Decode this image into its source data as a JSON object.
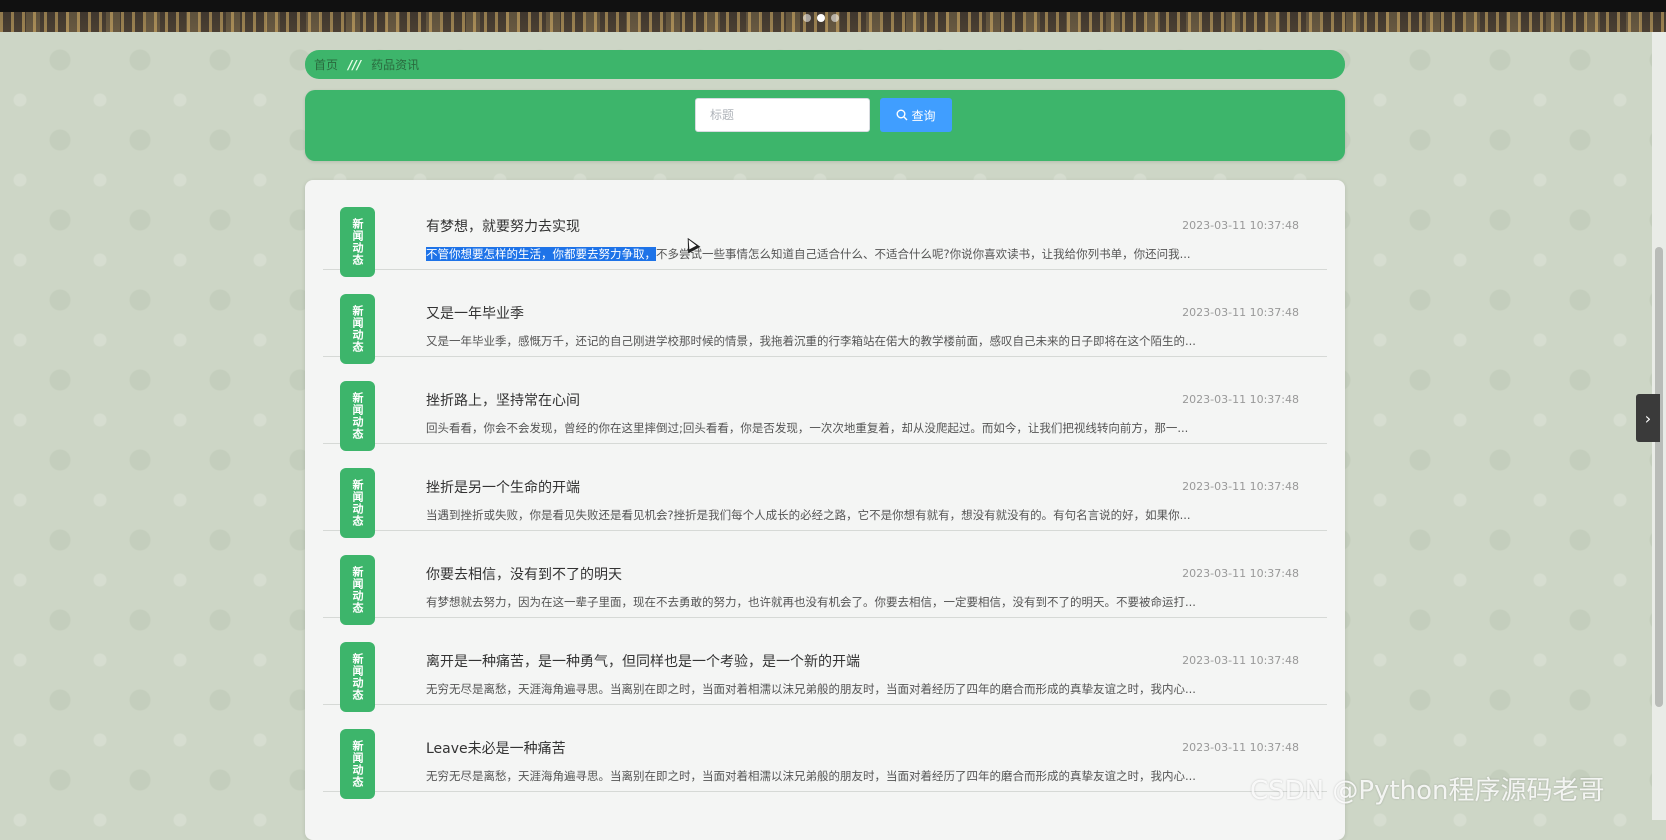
{
  "banner": {
    "slides": 3,
    "active_slide": 2
  },
  "breadcrumb": {
    "home": "首页",
    "separator": "///",
    "current": "药品资讯"
  },
  "search": {
    "placeholder": "标题",
    "value": "",
    "button_label": "查询",
    "button_icon": "search-icon"
  },
  "badge_text": "新闻动态",
  "news": [
    {
      "title": "有梦想，就要努力去实现",
      "time": "2023-03-11 10:37:48",
      "summary_selected": "不管你想要怎样的生活，你都要去努力争取，",
      "summary": "不多尝试一些事情怎么知道自己适合什么、不适合什么呢?你说你喜欢读书，让我给你列书单，你还问我..."
    },
    {
      "title": "又是一年毕业季",
      "time": "2023-03-11 10:37:48",
      "summary_selected": "",
      "summary": "又是一年毕业季，感慨万千，还记的自己刚进学校那时候的情景，我拖着沉重的行李箱站在偌大的教学楼前面，感叹自己未来的日子即将在这个陌生的..."
    },
    {
      "title": "挫折路上，坚持常在心间",
      "time": "2023-03-11 10:37:48",
      "summary_selected": "",
      "summary": "回头看看，你会不会发现，曾经的你在这里摔倒过;回头看看，你是否发现，一次次地重复着，却从没爬起过。而如今，让我们把视线转向前方，那一..."
    },
    {
      "title": "挫折是另一个生命的开端",
      "time": "2023-03-11 10:37:48",
      "summary_selected": "",
      "summary": "当遇到挫折或失败，你是看见失败还是看见机会?挫折是我们每个人成长的必经之路，它不是你想有就有，想没有就没有的。有句名言说的好，如果你..."
    },
    {
      "title": "你要去相信，没有到不了的明天",
      "time": "2023-03-11 10:37:48",
      "summary_selected": "",
      "summary": "有梦想就去努力，因为在这一辈子里面，现在不去勇敢的努力，也许就再也没有机会了。你要去相信，一定要相信，没有到不了的明天。不要被命运打..."
    },
    {
      "title": "离开是一种痛苦，是一种勇气，但同样也是一个考验，是一个新的开端",
      "time": "2023-03-11 10:37:48",
      "summary_selected": "",
      "summary": "无穷无尽是离愁，天涯海角遍寻思。当离别在即之时，当面对着相濡以沫兄弟般的朋友时，当面对着经历了四年的磨合而形成的真挚友谊之时，我内心..."
    },
    {
      "title": "Leave未必是一种痛苦",
      "time": "2023-03-11 10:37:48",
      "summary_selected": "",
      "summary": "无穷无尽是离愁，天涯海角遍寻思。当离别在即之时，当面对着相濡以沫兄弟般的朋友时，当面对着经历了四年的磨合而形成的真挚友谊之时，我内心..."
    }
  ],
  "watermark": "CSDN @Python程序源码老哥",
  "side_arrow": "›",
  "colors": {
    "primary_green": "#3db56b",
    "button_blue": "#409eff",
    "selection_blue": "#1e73e8"
  }
}
